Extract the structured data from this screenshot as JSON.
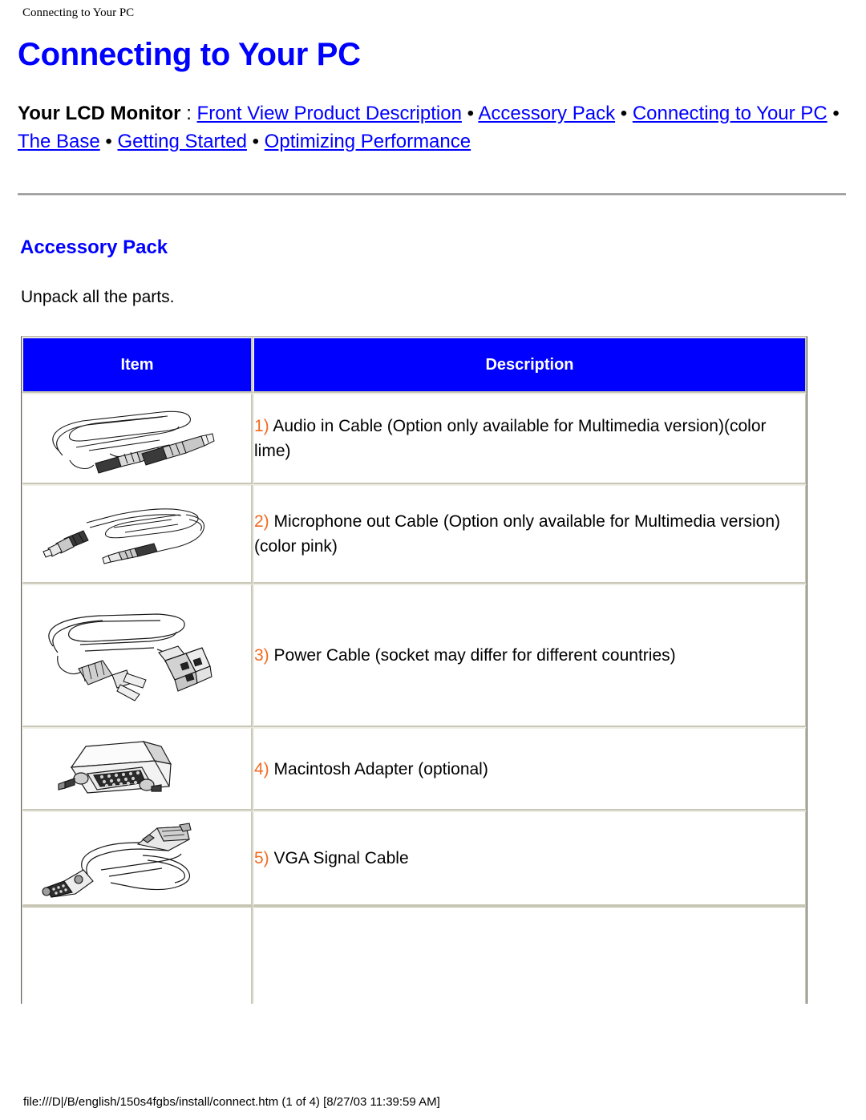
{
  "running_head": "Connecting to Your PC",
  "page_title": "Connecting to Your PC",
  "breadcrumb": {
    "label": "Your LCD Monitor",
    "colon": " : ",
    "separator": " • ",
    "links": [
      "Front View Product Description",
      "Accessory Pack",
      "Connecting to Your PC",
      "The Base",
      "Getting Started",
      "Optimizing Performance"
    ]
  },
  "section": {
    "title": "Accessory Pack",
    "intro": "Unpack all the parts."
  },
  "table": {
    "headers": [
      "Item",
      "Description"
    ],
    "rows": [
      {
        "num": "1)",
        "desc": " Audio in Cable (Option only available for Multimedia version)(color lime)",
        "image": "audio-in-cable-image"
      },
      {
        "num": "2)",
        "desc": " Microphone out Cable (Option only available for Multimedia version)(color pink)",
        "image": "microphone-out-cable-image"
      },
      {
        "num": "3)",
        "desc": " Power Cable (socket may differ for different countries)",
        "image": "power-cable-image"
      },
      {
        "num": "4)",
        "desc": " Macintosh Adapter (optional)",
        "image": "macintosh-adapter-image"
      },
      {
        "num": "5)",
        "desc": " VGA Signal Cable",
        "image": "vga-signal-cable-image"
      }
    ]
  },
  "footer": "file:///D|/B/english/150s4fgbs/install/connect.htm (1 of 4) [8/27/03 11:39:59 AM]",
  "colors": {
    "link": "#0000ff",
    "heading": "#0000ff",
    "table_header_bg": "#0000ff",
    "table_header_text": "#ffffff",
    "list_number": "#f26a21",
    "table_border": "#c8c6b4"
  }
}
